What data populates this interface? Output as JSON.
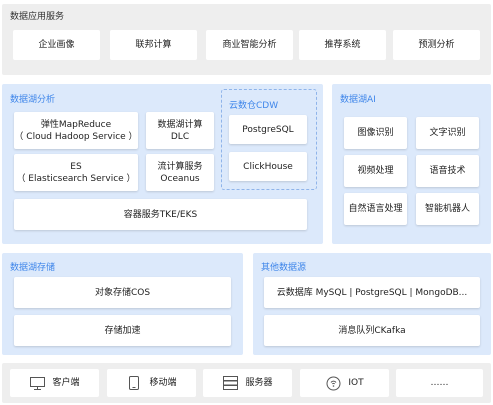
{
  "colors": {
    "accent": "#3f86ea",
    "panel_gray": "#eeeeee",
    "panel_blue": "#dce9fb",
    "box": "#ffffff",
    "text": "#222222"
  },
  "data_services": {
    "title": "数据应用服务",
    "items": [
      "企业画像",
      "联邦计算",
      "商业智能分析",
      "推荐系统",
      "预测分析"
    ]
  },
  "lake_analysis": {
    "title": "数据湖分析",
    "emr": [
      "弹性MapReduce",
      "（ Cloud Hadoop Service ）"
    ],
    "dlc": [
      "数据湖计算",
      "DLC"
    ],
    "es": [
      "ES",
      "（ Elasticsearch Service ）"
    ],
    "oceanus": [
      "流计算服务",
      "Oceanus"
    ],
    "tke": "容器服务TKE/EKS",
    "cdw": {
      "title": "云数仓CDW",
      "items": [
        "PostgreSQL",
        "ClickHouse"
      ]
    }
  },
  "lake_ai": {
    "title": "数据湖AI",
    "items": [
      "图像识别",
      "文字识别",
      "视频处理",
      "语音技术",
      "自然语言处理",
      "智能机器人"
    ]
  },
  "lake_storage": {
    "title": "数据湖存储",
    "items": [
      "对象存储COS",
      "存储加速"
    ]
  },
  "other_sources": {
    "title": "其他数据源",
    "items": [
      "云数据库 MySQL | PostgreSQL | MongoDB...",
      "消息队列CKafka"
    ]
  },
  "endpoints": [
    {
      "label": "客户端",
      "icon": "monitor-icon"
    },
    {
      "label": "移动端",
      "icon": "mobile-icon"
    },
    {
      "label": "服务器",
      "icon": "server-icon"
    },
    {
      "label": "IOT",
      "icon": "iot-icon"
    },
    {
      "label": "……",
      "icon": ""
    }
  ]
}
